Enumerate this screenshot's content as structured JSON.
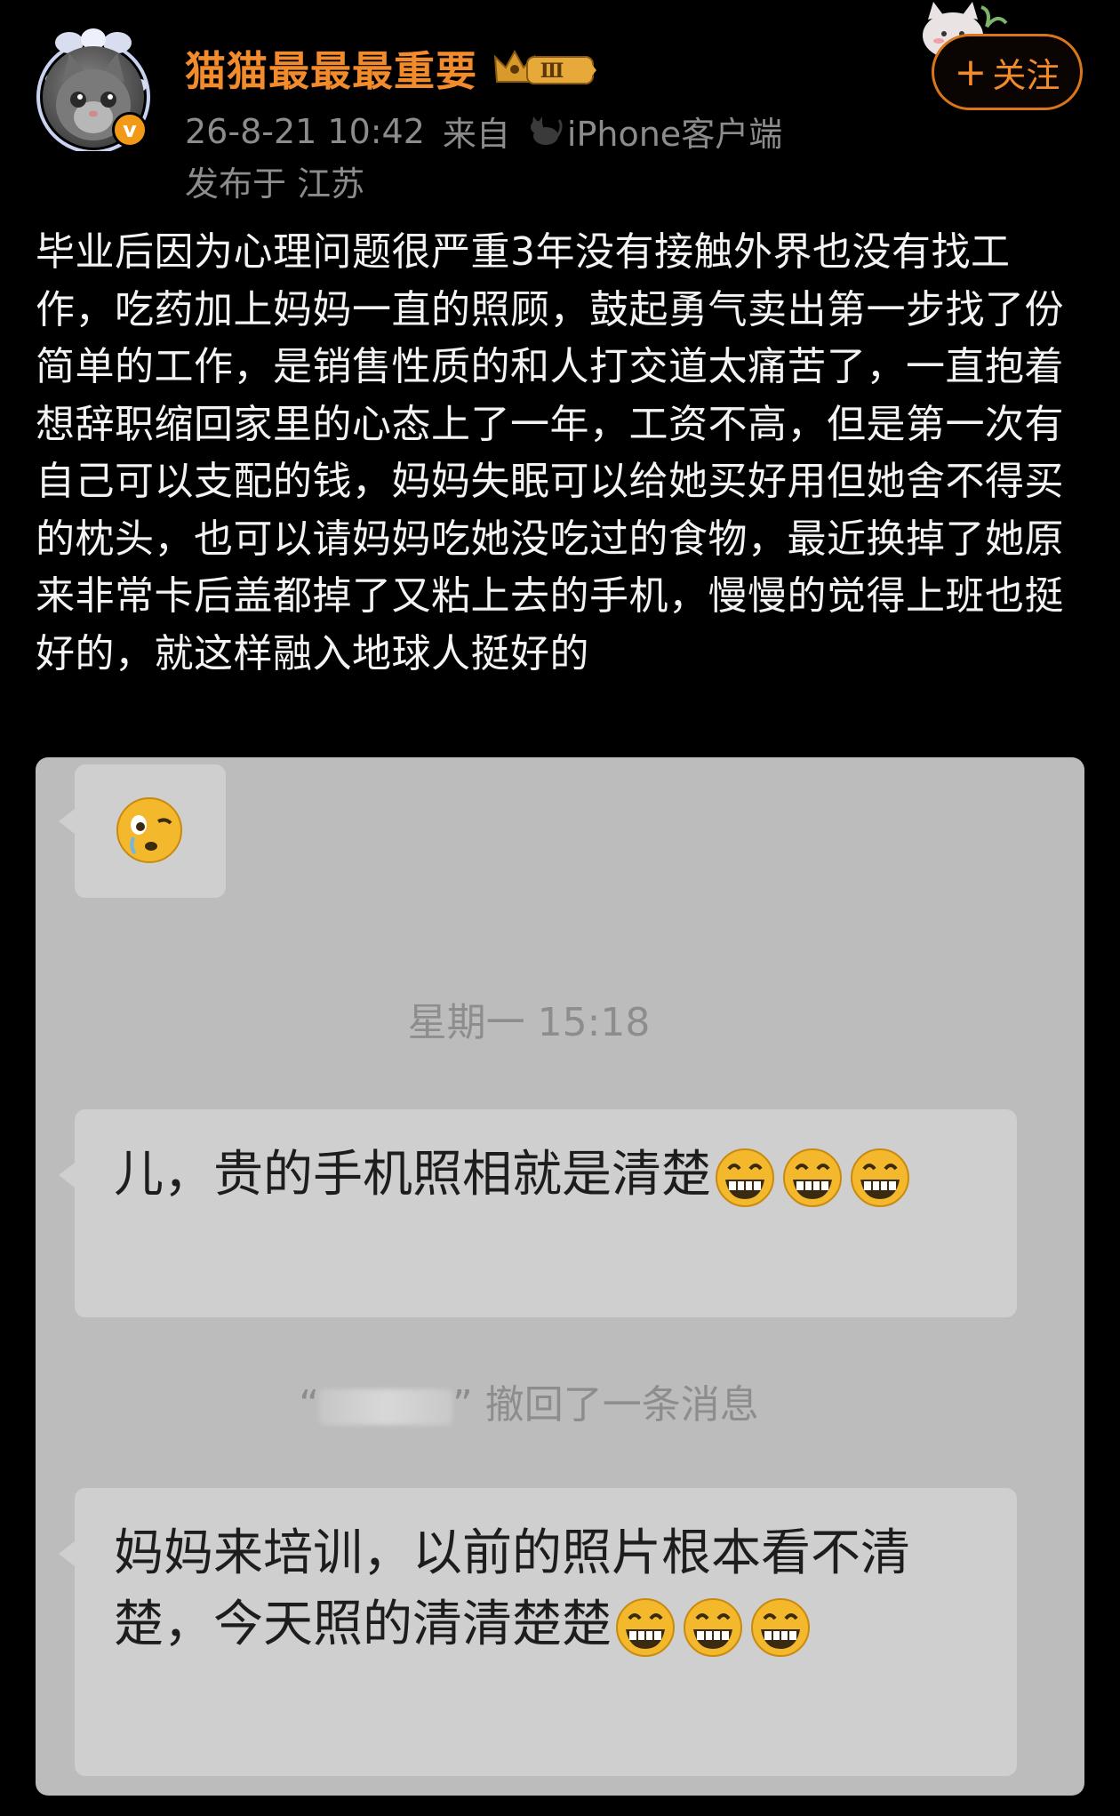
{
  "header": {
    "username": "猫猫最最最重要",
    "level_badge": "Ⅲ",
    "timestamp": "26-8-21 10:42",
    "source_prefix": "来自",
    "source_client": "iPhone客户端",
    "location": "发布于 江苏",
    "follow_label": "关注",
    "follow_plus": "+"
  },
  "post": {
    "text": "毕业后因为心理问题很严重3年没有接触外界也没有找工作，吃药加上妈妈一直的照顾，鼓起勇气卖出第一步找了份简单的工作，是销售性质的和人打交道太痛苦了，一直抱着想辞职缩回家里的心态上了一年，工资不高，但是第一次有自己可以支配的钱，妈妈失眠可以给她买好用但她舍不得买的枕头，也可以请妈妈吃她没吃过的食物，最近换掉了她原来非常卡后盖都掉了又粘上去的手机，慢慢的觉得上班也挺好的，就这样融入地球人挺好的"
  },
  "chat": {
    "time": "星期一 15:18",
    "message1": "儿，贵的手机照相就是清楚",
    "recall_text": "撤回了一条消息",
    "recall_quote_open": "“",
    "recall_quote_close": "”",
    "message2": "妈妈来培训，以前的照片根本看不清楚，今天照的清清楚楚"
  },
  "colors": {
    "background": "#000000",
    "username": "#f28b2c",
    "meta": "#8c8c8c",
    "body_text": "#f3f3f3",
    "chat_bg": "#bcbcbc",
    "bubble": "#cfcfcf"
  },
  "icons": {
    "avatar": "kitten-avatar",
    "verified": "verified-v-icon",
    "level": "crown-level-icon",
    "source": "cat-icon",
    "emoji1": "worried-face-emoji",
    "emoji2": "grinning-face-emoji"
  }
}
